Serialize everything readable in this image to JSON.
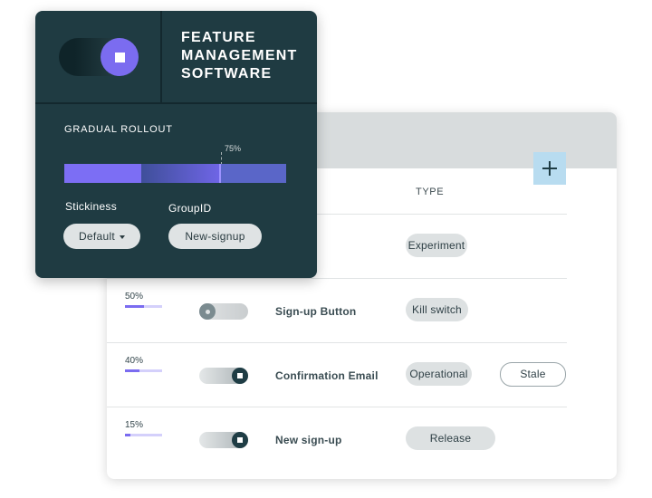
{
  "panel": {
    "title_lines": [
      "FEATURE",
      "MANAGEMENT",
      "SOFTWARE"
    ],
    "rollout_label": "GRADUAL ROLLOUT",
    "rollout_percent": 75,
    "rollout_percent_label": "75%",
    "stickiness_label": "Stickiness",
    "stickiness_value": "Default",
    "groupid_label": "GroupID",
    "groupid_value": "New-signup",
    "toggle_state": "on"
  },
  "table": {
    "column_type": "TYPE",
    "rows": [
      {
        "percent_label": "",
        "percent": null,
        "toggle": null,
        "name": "",
        "type": "Experiment",
        "extra_tag": ""
      },
      {
        "percent_label": "50%",
        "percent": 50,
        "toggle": "off",
        "name": "Sign-up Button",
        "type": "Kill switch",
        "extra_tag": ""
      },
      {
        "percent_label": "40%",
        "percent": 40,
        "toggle": "on",
        "name": "Confirmation Email",
        "type": "Operational",
        "extra_tag": "Stale"
      },
      {
        "percent_label": "15%",
        "percent": 15,
        "toggle": "on",
        "name": "New sign-up",
        "type": "Release",
        "extra_tag": ""
      }
    ]
  },
  "colors": {
    "panel_bg": "#1f3b42",
    "accent_purple": "#7b6cf0",
    "header_gray": "#d8dcdd",
    "add_button_blue": "#b8dcf0"
  },
  "icons": {
    "add": "plus-icon",
    "dropdown": "caret-down-icon"
  }
}
